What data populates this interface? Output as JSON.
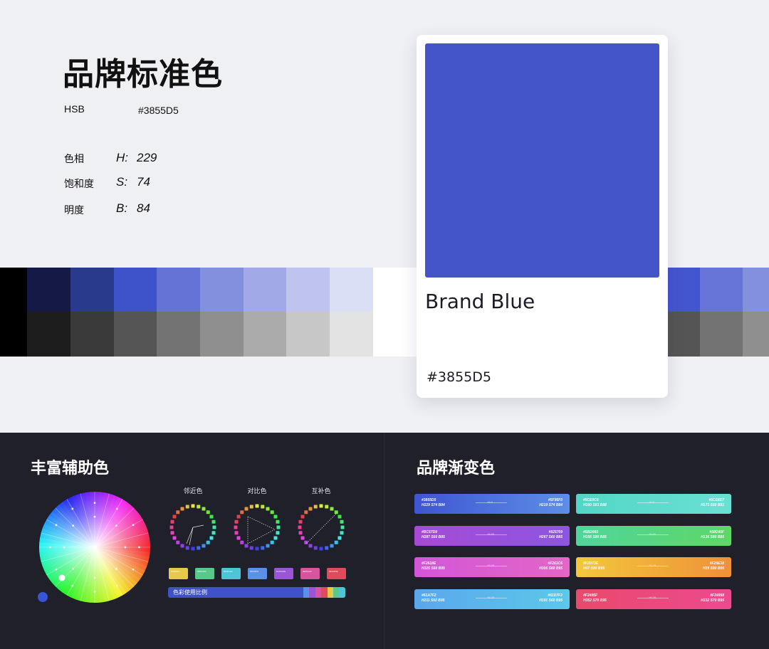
{
  "brand": {
    "title": "品牌标准色",
    "hsb_label": "HSB",
    "hex": "#3855D5",
    "properties": [
      {
        "label": "色相",
        "key": "H",
        "value": "229"
      },
      {
        "label": "饱和度",
        "key": "S",
        "value": "74"
      },
      {
        "label": "明度",
        "key": "B",
        "value": "84"
      }
    ],
    "colon": ":"
  },
  "card": {
    "name": "Brand Blue",
    "hex": "#3855D5",
    "swatch_color": "#4455CA"
  },
  "strip": {
    "blue_row": [
      "#000000",
      "#141a45",
      "#293a8d",
      "#3e52c9",
      "#6573d6",
      "#8390db",
      "#a1a9e6",
      "#bec4ee",
      "#dadff6",
      "#ffffff"
    ],
    "gray_row": [
      "#000000",
      "#1d1d1d",
      "#3a3a3a",
      "#555555",
      "#737373",
      "#8f8f8f",
      "#ababab",
      "#c7c7c7",
      "#e3e3e3",
      "#ffffff"
    ],
    "right_blue": [
      "#4455d0",
      "#6674d8",
      "#8390de"
    ],
    "right_gray": [
      "#555555",
      "#737373",
      "#8f8f8f"
    ]
  },
  "aux": {
    "title": "丰富辅助色",
    "wheel_labels": [
      "邻近色",
      "对比色",
      "互补色"
    ],
    "chips": [
      {
        "color": "#e8c84a",
        "code": "#F5D657"
      },
      {
        "color": "#59c98a",
        "code": "#5BD38F"
      },
      {
        "color": "#4cc6d6",
        "code": "#52D1E0"
      },
      {
        "color": "#5c8fe6",
        "code": "#5F95F0"
      },
      {
        "color": "#9a55d4",
        "code": "#A15ADE"
      },
      {
        "color": "#d6559e",
        "code": "#E05AA6"
      },
      {
        "color": "#e04a5a",
        "code": "#E94E5E"
      }
    ],
    "usage_label": "色彩使用比例",
    "usage_segments": [
      "#5d8fe6",
      "#9a55d4",
      "#d6559e",
      "#e04a5a",
      "#e8c84a",
      "#59c98a",
      "#4cc6d6"
    ]
  },
  "gradient": {
    "title": "品牌渐变色",
    "items": [
      {
        "from": "#3f55d2",
        "to": "#5d8ee8",
        "left_hex": "#3855D5",
        "left_hsb": "H229 S74 B84",
        "right_hex": "#5F95F0",
        "right_hsb": "H219 S74 B84",
        "mid": "+6.0"
      },
      {
        "from": "#52d6c6",
        "to": "#6ae0d3",
        "left_hex": "#5CE0C6",
        "left_hsb": "H160 S63 B88",
        "right_hex": "#5CE8D7",
        "right_hsb": "H173 S60 B91",
        "mid": "+6.0"
      },
      {
        "from": "#a64ad6",
        "to": "#8c56e0",
        "left_hex": "#BC57D9",
        "left_hsb": "H287 S60 B85",
        "right_hex": "#925709",
        "right_hsb": "H267 S60 B85",
        "mid": "+6.20"
      },
      {
        "from": "#4fd69b",
        "to": "#5ed766",
        "left_hex": "#5BD993",
        "left_hsb": "H156 S80 B85",
        "right_hex": "#58D95F",
        "right_hsb": "H136 S80 B85",
        "mid": "+6.20"
      },
      {
        "from": "#d456d8",
        "to": "#e266c6",
        "left_hex": "#F2618E",
        "left_hsb": "H325 S60 B95",
        "right_hex": "#F261C6",
        "right_hsb": "H305 S60 B95",
        "mid": "+6.20"
      },
      {
        "from": "#f2c83c",
        "to": "#ef9138",
        "left_hex": "#F2D73E",
        "left_hsb": "H47 S80 B95",
        "right_hex": "#F29E38",
        "right_hsb": "H29 S80 B95",
        "mid": "+5.20"
      },
      {
        "from": "#5aa7ec",
        "to": "#5cc8ea",
        "left_hex": "#61A7F2",
        "left_hsb": "H211 S60 B95",
        "right_hex": "#61D7F2",
        "right_hsb": "H191 S60 B95",
        "mid": "+6.20"
      },
      {
        "from": "#e84a6c",
        "to": "#ec4a8f",
        "left_hex": "#F2495F",
        "left_hsb": "H352 S70 B95",
        "right_hex": "#F24998",
        "right_hsb": "H332 S70 B95",
        "mid": "+5.20"
      }
    ]
  }
}
